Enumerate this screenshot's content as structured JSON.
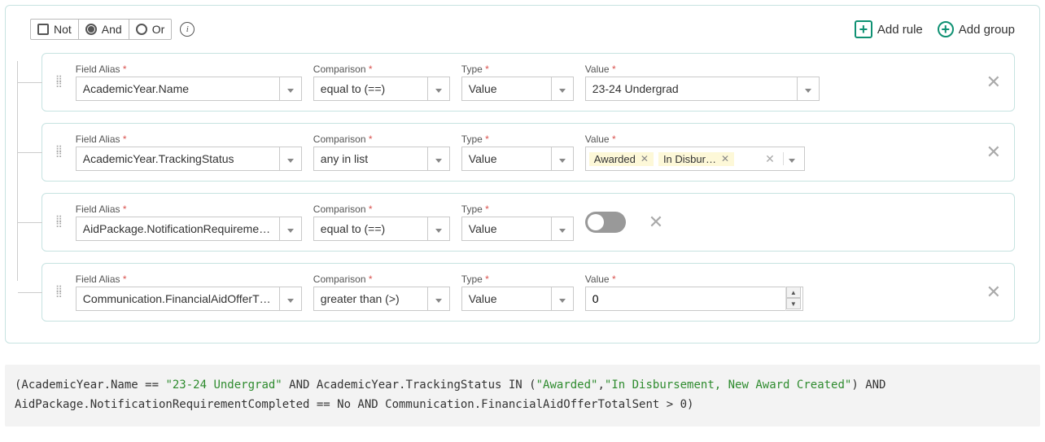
{
  "header": {
    "not_label": "Not",
    "and_label": "And",
    "or_label": "Or",
    "add_rule_label": "Add rule",
    "add_group_label": "Add group"
  },
  "labels": {
    "field_alias": "Field Alias",
    "comparison": "Comparison",
    "type": "Type",
    "value": "Value"
  },
  "rules": [
    {
      "field_alias": "AcademicYear.Name",
      "comparison": "equal to (==)",
      "type": "Value",
      "value_kind": "text",
      "value_text": "23-24 Undergrad"
    },
    {
      "field_alias": "AcademicYear.TrackingStatus",
      "comparison": "any in list",
      "type": "Value",
      "value_kind": "chips",
      "chips": [
        "Awarded",
        "In Disbur…"
      ]
    },
    {
      "field_alias": "AidPackage.NotificationRequireme…",
      "comparison": "equal to (==)",
      "type": "Value",
      "value_kind": "toggle",
      "toggle_on": false
    },
    {
      "field_alias": "Communication.FinancialAidOfferT…",
      "comparison": "greater than (>)",
      "type": "Value",
      "value_kind": "number",
      "value_number": "0"
    }
  ],
  "expression": {
    "parts": [
      {
        "t": "plain",
        "v": "(AcademicYear.Name == "
      },
      {
        "t": "str",
        "v": "\"23-24 Undergrad\""
      },
      {
        "t": "plain",
        "v": " AND AcademicYear.TrackingStatus IN ("
      },
      {
        "t": "str",
        "v": "\"Awarded\""
      },
      {
        "t": "plain",
        "v": ","
      },
      {
        "t": "str",
        "v": "\"In Disbursement, New Award Created\""
      },
      {
        "t": "plain",
        "v": ") AND AidPackage.NotificationRequirementCompleted == No AND Communication.FinancialAidOfferTotalSent > 0)"
      }
    ]
  }
}
